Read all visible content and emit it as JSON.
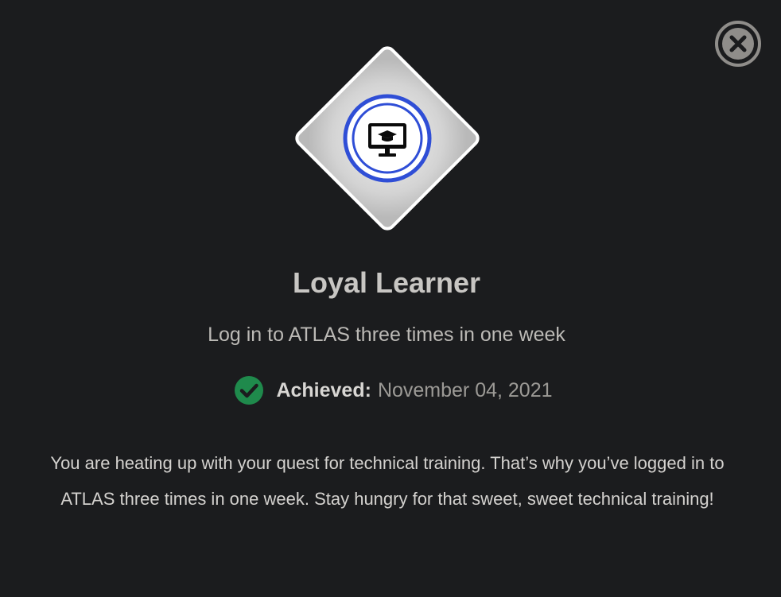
{
  "badge": {
    "title": "Loyal Learner",
    "subtitle": "Log in to ATLAS three times in one week",
    "icon": "monitor-graduation-cap-icon",
    "accent_color": "#2f4ed6"
  },
  "achievement": {
    "label": "Achieved:",
    "date": "November 04, 2021",
    "status_color": "#1f8a4c"
  },
  "description": "You are heating up with your quest for technical training. That’s why you’ve logged in to ATLAS three times in one week. Stay hungry for that sweet, sweet technical training!",
  "close": {
    "icon": "close-icon"
  }
}
